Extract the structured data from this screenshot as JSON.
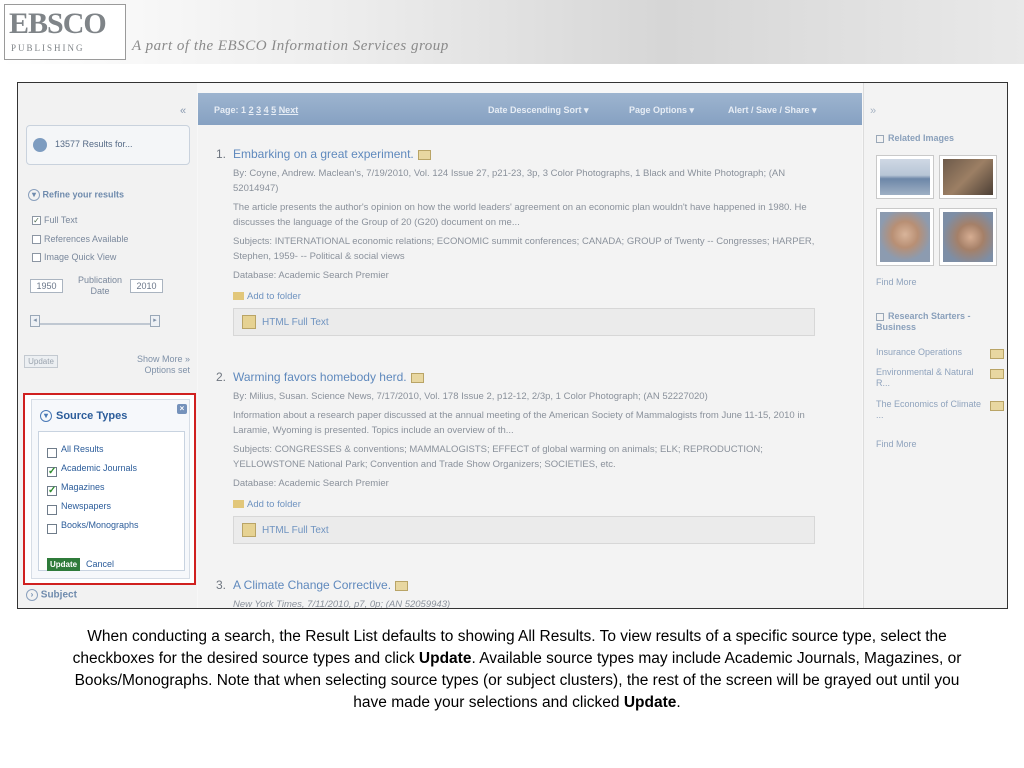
{
  "banner": {
    "logo_main": "EBSCO",
    "logo_sub": "PUBLISHING",
    "tagline": "A part of the EBSCO Information Services group"
  },
  "left_panel": {
    "collapse_glyph": "«",
    "results_label": "13577 Results for...",
    "refine_title": "Refine your results",
    "filters": [
      {
        "label": "Full Text",
        "checked": true
      },
      {
        "label": "References Available",
        "checked": false
      },
      {
        "label": "Image Quick View",
        "checked": false
      }
    ],
    "date_from": "1950",
    "date_to": "2010",
    "publication_date_label": "Publication Date",
    "update_label": "Update",
    "show_more_label": "Show More »",
    "options_set_label": "Options set"
  },
  "source_types": {
    "title": "Source Types",
    "close_glyph": "×",
    "items": [
      {
        "label": "All Results",
        "checked": false
      },
      {
        "label": "Academic Journals",
        "checked": true
      },
      {
        "label": "Magazines",
        "checked": true
      },
      {
        "label": "Newspapers",
        "checked": false
      },
      {
        "label": "Books/Monographs",
        "checked": false
      }
    ],
    "update_label": "Update",
    "cancel_label": "Cancel"
  },
  "subject_label": "Subject",
  "toolbar": {
    "page_label": "Page:",
    "pages": [
      "1",
      "2",
      "3",
      "4",
      "5"
    ],
    "next_label": "Next",
    "sort_label": "Date Descending Sort ▾",
    "page_options_label": "Page Options ▾",
    "alert_label": "Alert / Save / Share ▾"
  },
  "results": [
    {
      "num": "1.",
      "title": "Embarking on a great experiment.",
      "byline": "By: Coyne, Andrew. Maclean's, 7/19/2010, Vol. 124 Issue 27, p21-23, 3p, 3 Color Photographs, 1 Black and White Photograph; (AN 52014947)",
      "abstract": "The article presents the author's opinion on how the world leaders' agreement on an economic plan wouldn't have happened in 1980. He discusses the language of the Group of 20 (G20) document on me...",
      "subjects": "Subjects: INTERNATIONAL economic relations; ECONOMIC summit conferences; CANADA; GROUP of Twenty -- Congresses; HARPER, Stephen, 1959- -- Political & social views",
      "database": "Database: Academic Search Premier",
      "add_folder": "Add to folder",
      "full_text": "HTML Full Text"
    },
    {
      "num": "2.",
      "title": "Warming favors homebody herd.",
      "byline": "By: Milius, Susan. Science News, 7/17/2010, Vol. 178 Issue 2, p12-12, 2/3p, 1 Color Photograph; (AN 52227020)",
      "abstract": "Information about a research paper discussed at the annual meeting of the American Society of Mammalogists from June 11-15, 2010 in Laramie, Wyoming is presented. Topics include an overview of th...",
      "subjects": "Subjects: CONGRESSES & conventions; MAMMALOGISTS; EFFECT of global warming on animals; ELK; REPRODUCTION; YELLOWSTONE National Park; Convention and Trade Show Organizers; SOCIETIES, etc.",
      "database": "Database: Academic Search Premier",
      "add_folder": "Add to folder",
      "full_text": "HTML Full Text"
    },
    {
      "num": "3.",
      "title": "A Climate Change Corrective.",
      "byline": "New York Times, 7/11/2010, p7, 0p; (AN 52059943)"
    }
  ],
  "right_panel": {
    "collapse_glyph": "»",
    "related_images_title": "Related Images",
    "find_more_1": "Find More",
    "research_starters_title": "Research Starters - Business",
    "starters": [
      "Insurance Operations",
      "Environmental & Natural R...",
      "The Economics of Climate ..."
    ],
    "find_more_2": "Find More"
  },
  "caption": {
    "part1": "When conducting a search, the Result List defaults to showing All Results. To view results of a specific source type,  select the checkboxes for the desired source types and click ",
    "bold1": "Update",
    "part2": ".  Available source types may include Academic Journals, Magazines, or Books/Monographs. Note that when selecting source types (or subject clusters), the rest of the screen will be grayed out until you have made your selections and clicked ",
    "bold2": "Update",
    "part3": "."
  },
  "colors": {
    "highlight_border": "#d0201f",
    "toolbar": "#8fa9c8",
    "link": "#5f89bd",
    "update_button": "#2f7b3a"
  }
}
